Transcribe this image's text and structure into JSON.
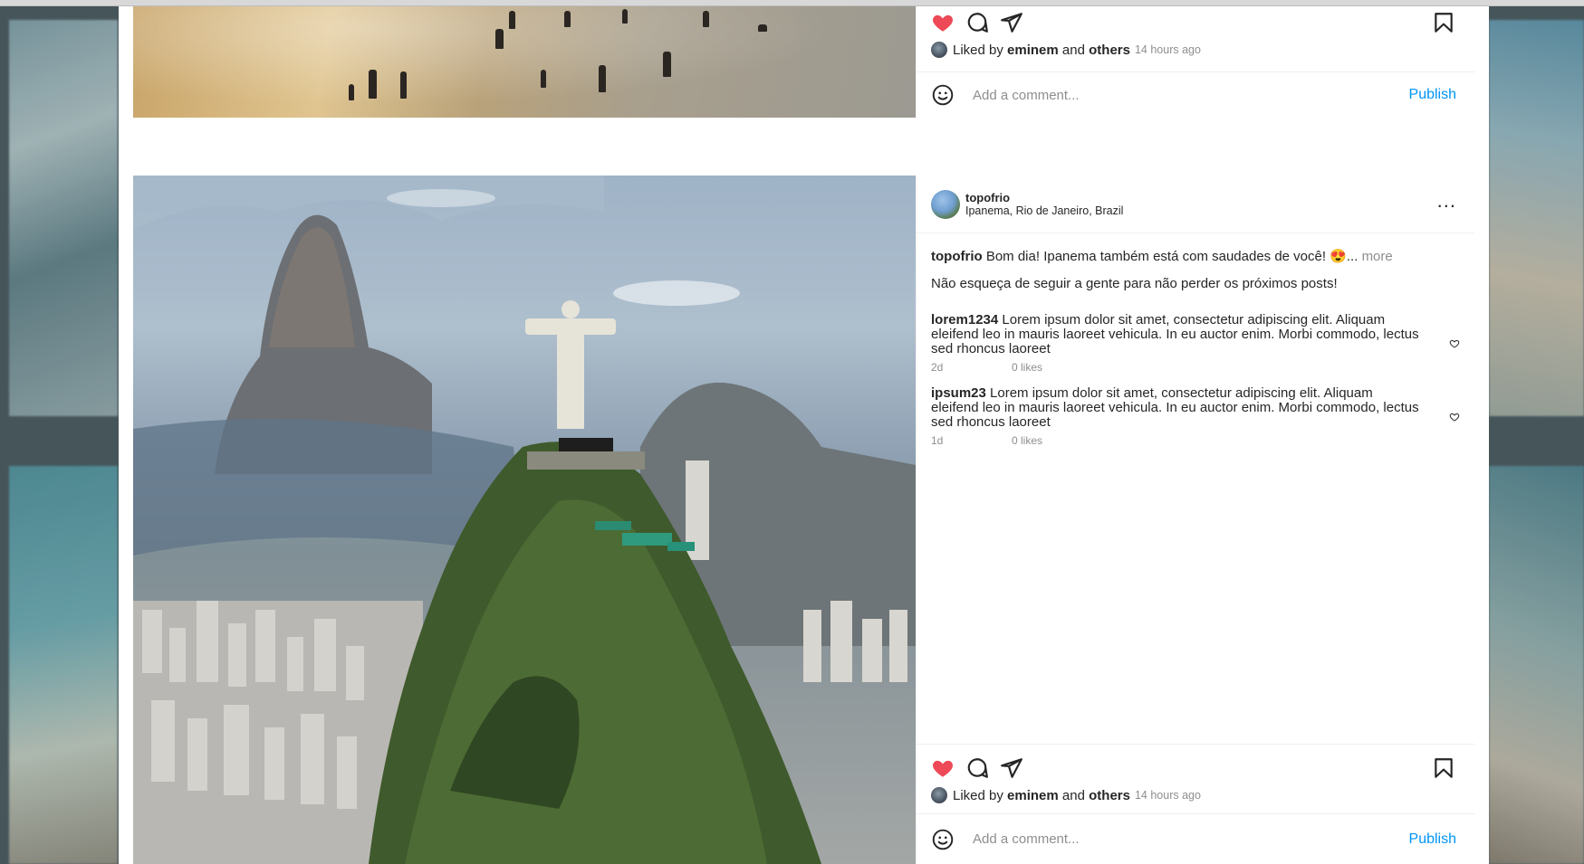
{
  "colors": {
    "like": "#ed4956",
    "link": "#0095f6",
    "muted": "#8e8e8e",
    "text": "#262626"
  },
  "top_post": {
    "icons": [
      "heart-filled-icon",
      "comment-icon",
      "share-icon",
      "bookmark-icon"
    ],
    "liked_by_prefix": "Liked by",
    "liked_by_user": "eminem",
    "liked_by_and": "and",
    "liked_by_others": "others",
    "time_ago": "14 hours ago",
    "comment_placeholder": "Add a comment...",
    "publish_label": "Publish"
  },
  "main_post": {
    "username": "topofrio",
    "location": "Ipanema, Rio de Janeiro, Brazil",
    "more_label": "...",
    "caption_user": "topofrio",
    "caption_text": "Bom dia! Ipanema também está com saudades de você! 😍...",
    "caption_more": "more",
    "caption_line2": "Não esqueça de seguir a gente para não perder os próximos posts!",
    "comments": [
      {
        "user": "lorem1234",
        "text": "Lorem ipsum dolor sit amet, consectetur adipiscing elit. Aliquam eleifend leo in mauris laoreet vehicula. In eu auctor enim. Morbi commodo, lectus sed rhoncus laoreet",
        "age": "2d",
        "likes": "0 likes"
      },
      {
        "user": "ipsum23",
        "text": "Lorem ipsum dolor sit amet, consectetur adipiscing elit. Aliquam eleifend leo in mauris laoreet vehicula. In eu auctor enim. Morbi commodo, lectus sed rhoncus laoreet",
        "age": "1d",
        "likes": "0 likes"
      }
    ],
    "liked_by_prefix": "Liked by",
    "liked_by_user": "eminem",
    "liked_by_and": "and",
    "liked_by_others": "others",
    "time_ago": "14 hours ago",
    "comment_placeholder": "Add a comment...",
    "publish_label": "Publish"
  }
}
